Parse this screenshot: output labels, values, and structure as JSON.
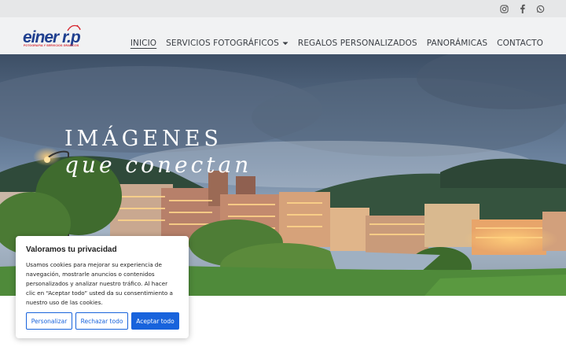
{
  "topbar": {
    "social": [
      {
        "icon": "instagram-icon"
      },
      {
        "icon": "facebook-icon"
      },
      {
        "icon": "whatsapp-icon"
      }
    ]
  },
  "header": {
    "logo_text": "einer r.p",
    "logo_subtext": "FOTOGRAFIA Y SERVICIOS GRAFICOS",
    "nav": [
      {
        "label": "INICIO",
        "active": true
      },
      {
        "label": "SERVICIOS FOTOGRÁFICOS",
        "dropdown": true
      },
      {
        "label": "REGALOS PERSONALIZADOS"
      },
      {
        "label": "PANORÁMICAS"
      },
      {
        "label": "CONTACTO"
      }
    ]
  },
  "hero": {
    "line1": "IMÁGENES",
    "line2": "que conectan"
  },
  "cookie": {
    "title": "Valoramos tu privacidad",
    "text": "Usamos cookies para mejorar su experiencia de navegación, mostrarle anuncios o contenidos personalizados y analizar nuestro tráfico. Al hacer clic en “Aceptar todo” usted da su consentimiento a nuestro uso de las cookies.",
    "btn_customize": "Personalizar",
    "btn_reject": "Rechazar todo",
    "btn_accept": "Aceptar todo"
  },
  "colors": {
    "accent": "#1863dc",
    "logo_blue": "#1f3f8f",
    "logo_red": "#d7262f"
  }
}
